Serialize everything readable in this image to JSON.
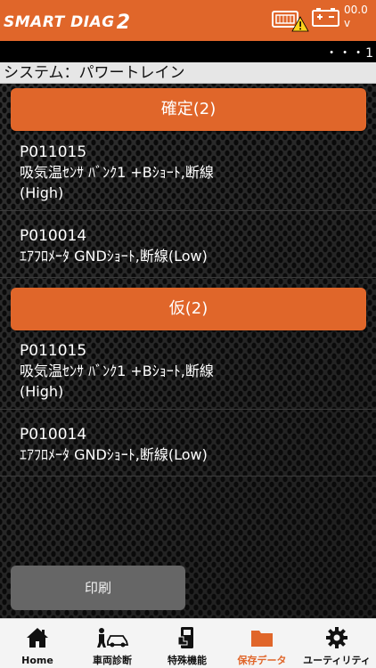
{
  "header": {
    "logo_text": "SMART DIAG",
    "logo_num": "2",
    "voltage_value": "00.0",
    "voltage_unit": "v"
  },
  "status_bar": {
    "dots": "・・・1"
  },
  "system": {
    "label": "システム：パワートレイン"
  },
  "sections": [
    {
      "title": "確定(2)",
      "items": [
        {
          "code": "P011015",
          "desc_line1": "吸気温ｾﾝｻ ﾊﾞﾝｸ1 +Bｼｮｰﾄ,断線",
          "desc_line2": "(High)"
        },
        {
          "code": "P010014",
          "desc_line1": "ｴｱﾌﾛﾒｰﾀ GNDｼｮｰﾄ,断線(Low)",
          "desc_line2": ""
        }
      ]
    },
    {
      "title": "仮(2)",
      "items": [
        {
          "code": "P011015",
          "desc_line1": "吸気温ｾﾝｻ ﾊﾞﾝｸ1 +Bｼｮｰﾄ,断線",
          "desc_line2": "(High)"
        },
        {
          "code": "P010014",
          "desc_line1": "ｴｱﾌﾛﾒｰﾀ GNDｼｮｰﾄ,断線(Low)",
          "desc_line2": ""
        }
      ]
    }
  ],
  "print_button": {
    "label": "印刷"
  },
  "tabs": [
    {
      "label": "Home",
      "icon": "home-icon",
      "active": false
    },
    {
      "label": "車両診断",
      "icon": "car-diagnosis-icon",
      "active": false
    },
    {
      "label": "特殊機能",
      "icon": "special-function-icon",
      "active": false
    },
    {
      "label": "保存データ",
      "icon": "folder-icon",
      "active": true
    },
    {
      "label": "ユーティリティ",
      "icon": "gear-icon",
      "active": false
    }
  ],
  "colors": {
    "accent": "#e0662a",
    "background": "#1c1c1c",
    "print_button": "#666666",
    "tabbar": "#f4f4f4"
  }
}
